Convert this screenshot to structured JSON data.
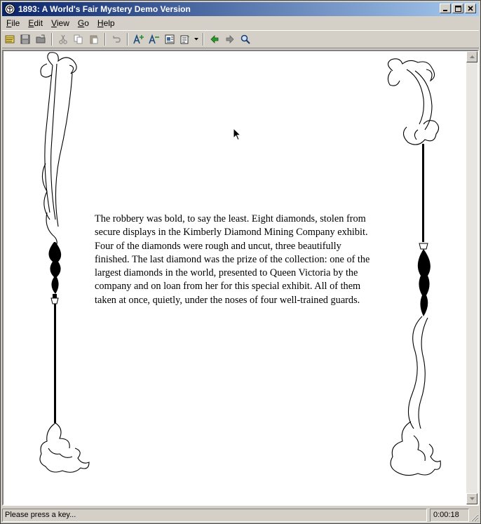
{
  "window": {
    "title": "1893: A World's Fair Mystery Demo Version"
  },
  "menu": [
    {
      "first": "F",
      "rest": "ile"
    },
    {
      "first": "E",
      "rest": "dit"
    },
    {
      "first": "V",
      "rest": "iew"
    },
    {
      "first": "G",
      "rest": "o"
    },
    {
      "first": "H",
      "rest": "elp"
    }
  ],
  "toolbar": {
    "icons": [
      "open-icon",
      "save-icon",
      "export-icon",
      "cut-icon",
      "copy-icon",
      "paste-icon",
      "undo-icon",
      "font-larger-icon",
      "font-smaller-icon",
      "notes-icon",
      "bookmark-icon",
      "back-icon",
      "forward-icon",
      "search-icon"
    ]
  },
  "story": {
    "text": "The robbery was bold, to say the least. Eight diamonds, stolen from secure displays in the Kimberly Diamond Mining Company exhibit. Four of the diamonds were rough and uncut, three beautifully finished. The last diamond was the prize of the collection: one of the largest diamonds in the world, presented to Queen Victoria by the company and on loan from her for this special exhibit. All of them taken at once, quietly, under the noses of four well-trained guards."
  },
  "status": {
    "message": "Please press a key...",
    "timer": "0:00:18"
  },
  "colors": {
    "title_start": "#0a246a",
    "title_end": "#a6caf0",
    "chrome": "#d4d0c8"
  }
}
